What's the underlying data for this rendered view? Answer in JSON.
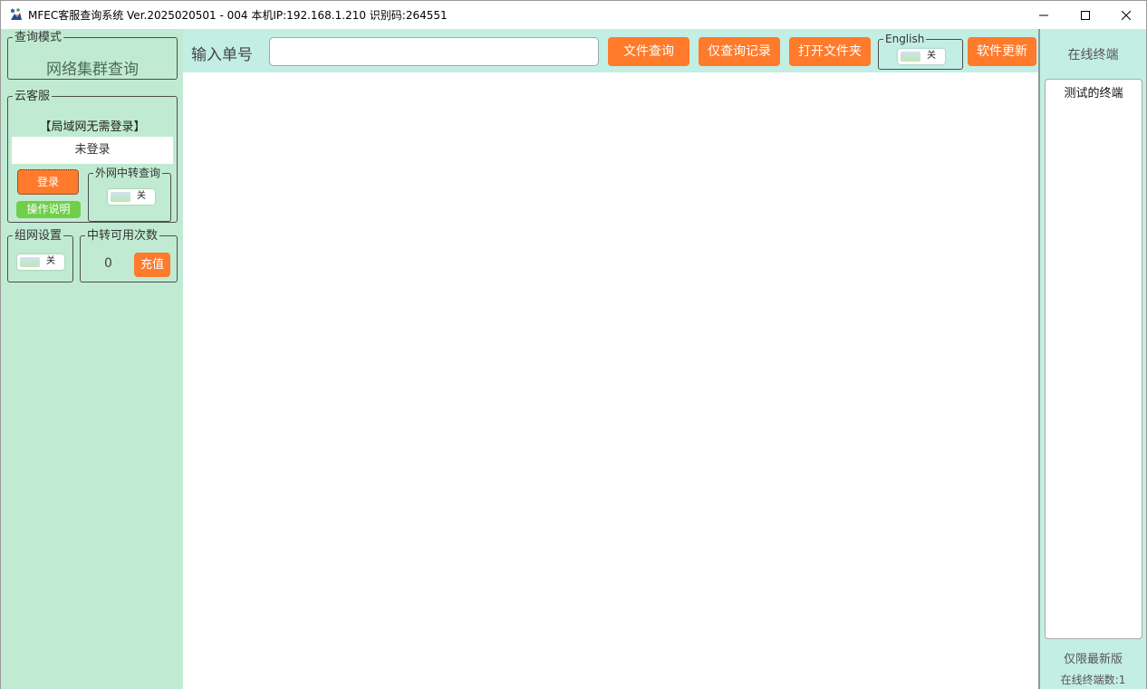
{
  "window": {
    "title": "MFEC客服查询系统 Ver.2025020501 - 004 本机IP:192.168.1.210 识别码:264551"
  },
  "query_mode": {
    "legend": "查询模式",
    "value": "网络集群查询"
  },
  "cloud_service": {
    "legend": "云客服",
    "lan_note": "【局域网无需登录】",
    "login_status": "未登录",
    "login_button": "登录",
    "help_button": "操作说明",
    "relay_query": {
      "legend": "外网中转查询",
      "toggle_label": "关"
    }
  },
  "network_setting": {
    "legend": "组网设置",
    "toggle_label": "关"
  },
  "relay_count": {
    "legend": "中转可用次数",
    "value": "0",
    "recharge_button": "充值"
  },
  "toolbar": {
    "order_label": "输入单号",
    "order_value": "",
    "file_query": "文件查询",
    "record_query": "仅查询记录",
    "open_folder": "打开文件夹",
    "english_legend": "English",
    "english_toggle": "关",
    "update": "软件更新"
  },
  "right_panel": {
    "title": "在线终端",
    "terminals": [
      "测试的终端"
    ],
    "note": "仅限最新版",
    "online_count": "在线终端数:1"
  },
  "colors": {
    "left_bg": "#c0ebd2",
    "toolbar_bg": "#c3eee4",
    "accent_orange": "#ff7a2b",
    "accent_green": "#6fcf4a"
  }
}
